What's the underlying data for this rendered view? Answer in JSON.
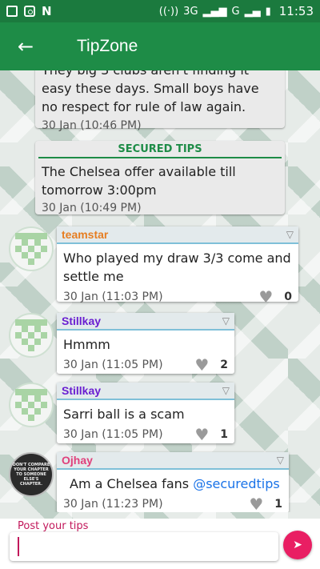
{
  "status_bar": {
    "network": "3G",
    "network2": "G",
    "time": "11:53",
    "icons": [
      "image-icon",
      "camera-icon",
      "n-icon",
      "hotspot-icon",
      "signal-icon",
      "battery-icon"
    ]
  },
  "app_bar": {
    "title": "TipZone"
  },
  "feed": {
    "prev_message": {
      "text": "They big 3 clubs aren't finding it easy these days. Small boys have no respect for rule of law again.",
      "time": "30 Jan  (10:46 PM)"
    },
    "secured_tip": {
      "tag": "SECURED TIPS",
      "text": "The Chelsea offer available till tomorrow 3:00pm",
      "time": "30 Jan  (10:49 PM)"
    },
    "messages": [
      {
        "user": "teamstar",
        "user_color": "#e67e22",
        "text": "Who played my draw 3/3 come and settle me",
        "time": "30 Jan  (11:03 PM)",
        "likes": "0"
      },
      {
        "user": "Stillkay",
        "user_color": "#6a1fd1",
        "text": "Hmmm",
        "time": "30 Jan  (11:05 PM)",
        "likes": "2"
      },
      {
        "user": "Stillkay",
        "user_color": "#6a1fd1",
        "text": "Sarri ball is a scam",
        "time": "30 Jan  (11:05 PM)",
        "likes": "1"
      },
      {
        "user": "Ojhay",
        "user_color": "#e0407b",
        "text": "Am a Chelsea fans",
        "mention": "@securedtips",
        "time": "30 Jan  (11:23 PM)",
        "likes": "1",
        "avatar_text": "DON'T COMPARE YOUR CHAPTER TO SOMEONE ELSE'S CHAPTER."
      }
    ]
  },
  "composer": {
    "label": "Post your tips"
  },
  "colors": {
    "primary": "#1e8c47",
    "accent": "#e91e63"
  }
}
